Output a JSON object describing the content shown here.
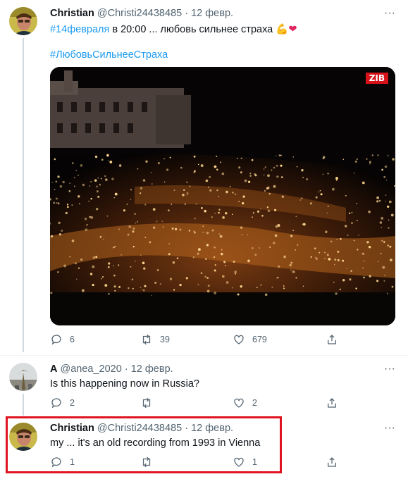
{
  "tweets": [
    {
      "name": "Christian",
      "handle": "@Christi24438485",
      "date": "12 февр.",
      "text_pre": "#14февраля",
      "text_mid": " в 20:00 ... любовь сильнее страха ",
      "text_emoji": "💪❤",
      "hashtag2": "#ЛюбовьСильнееСтраха",
      "media_badge": "ZIB",
      "reply_count": "6",
      "retweet_count": "39",
      "like_count": "679"
    },
    {
      "name": "A",
      "handle": "@anea_2020",
      "date": "12 февр.",
      "text": "Is this happening now in Russia?",
      "reply_count": "2",
      "retweet_count": "",
      "like_count": "2"
    },
    {
      "name": "Christian",
      "handle": "@Christi24438485",
      "date": "12 февр.",
      "text": "my ... it's an old recording from 1993 in Vienna",
      "reply_count": "1",
      "retweet_count": "",
      "like_count": "1"
    }
  ],
  "separator": " · ",
  "more_label": "···",
  "colors": {
    "accent": "#1d9bf0",
    "muted": "#536471",
    "highlight": "#e0141e"
  }
}
